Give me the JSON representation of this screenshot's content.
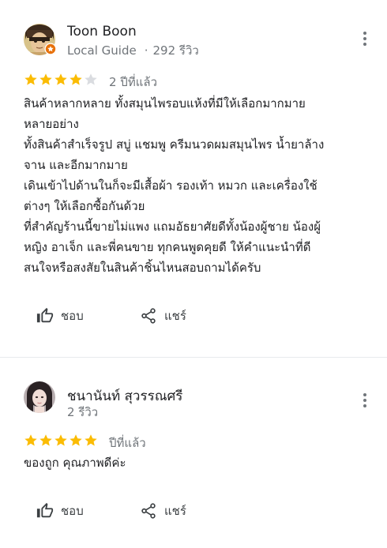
{
  "reviews": [
    {
      "author": "Toon Boon",
      "badge": "Local Guide",
      "separator": "·",
      "review_count": "292 รีวิว",
      "rating": 4,
      "max_rating": 5,
      "time": "2 ปีที่แล้ว",
      "text_lines": [
        "สินค้าหลากหลาย ทั้งสมุนไพรอบแห้งที่มีให้เลือกมากมาย",
        "หลายอย่าง",
        "ทั้งสินค้าสำเร็จรูป สบู่ แชมพู ครีมนวดผมสมุนไพร น้ำยาล้าง",
        "จาน และอีกมากมาย",
        "เดินเข้าไปด้านในก็จะมีเสื้อผ้า รองเท้า หมวก และเครื่องใช้",
        "ต่างๆ ให้เลือกซื้อกันด้วย",
        "ที่สำคัญร้านนี้ขายไม่แพง แถมอัธยาศัยดีทั้งน้องผู้ชาย น้องผู้",
        "หญิง อาเจ็ก และพี่คนขาย ทุกคนพูดคุยดี ให้คำแนะนำที่ดี",
        "สนใจหรือสงสัยในสินค้าชิ้นไหนสอบถามได้ครับ"
      ],
      "like_label": "ชอบ",
      "share_label": "แชร์"
    },
    {
      "author": "ชนานันท์ สุวรรณศรี",
      "review_count": "2 รีวิว",
      "rating": 5,
      "max_rating": 5,
      "time": "ปีที่แล้ว",
      "text_lines": [
        "ของถูก คุณภาพดีค่ะ"
      ],
      "like_label": "ชอบ",
      "share_label": "แชร์"
    }
  ],
  "colors": {
    "star_filled": "#fbbc04",
    "star_empty": "#dadce0",
    "secondary_text": "#70757a",
    "separator": "#e8eaed",
    "local_guide_badge": "#e8710a"
  },
  "icons": {
    "more": "more-vert-icon",
    "like": "thumb-up-icon",
    "share": "share-icon",
    "local_guide": "local-guide-badge-icon"
  }
}
